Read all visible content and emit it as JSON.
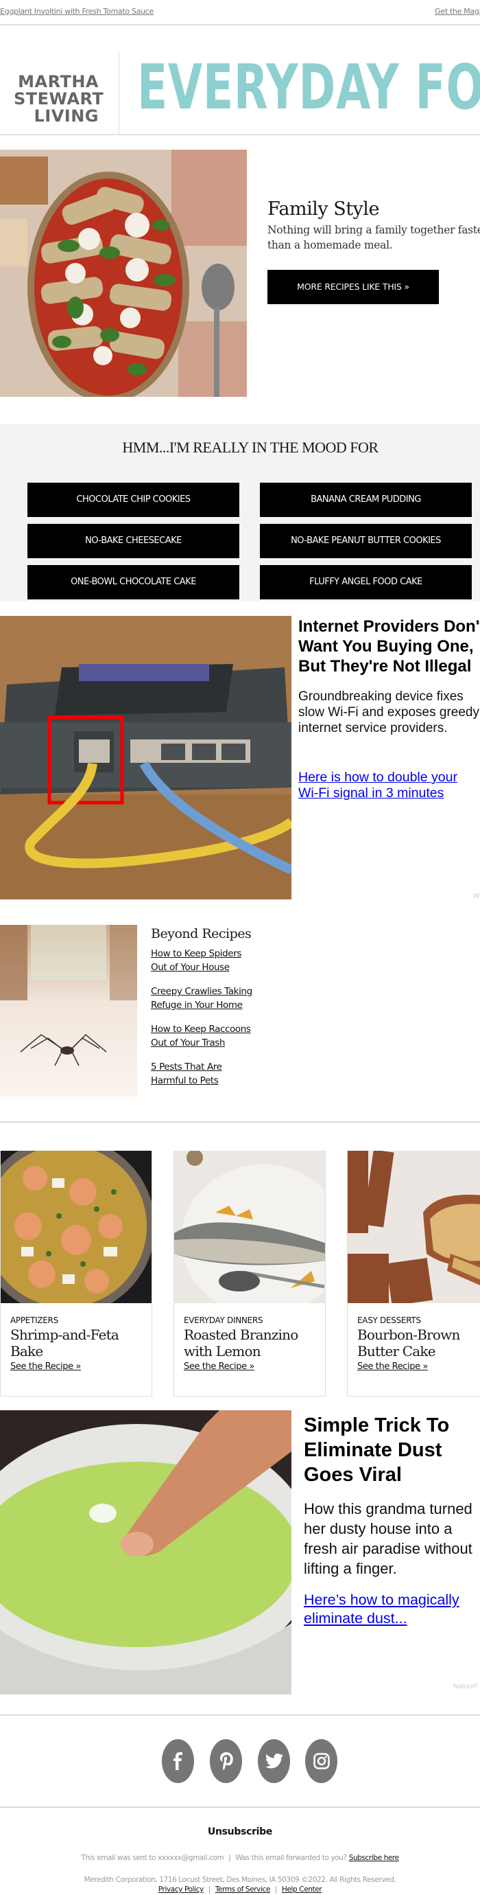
{
  "topbar": {
    "left_link": "Eggplant Involtini with Fresh Tomato Sauce",
    "right_link": "Get the Magazine"
  },
  "header": {
    "brand_lines": [
      "MARTHA",
      "STEWART",
      "LIVING"
    ],
    "newsletter_title": "EVERYDAY FOOD",
    "accent_color": "#8ecfcf"
  },
  "hero": {
    "image_alt": "Eggplant involtini in tomato sauce with basil",
    "title": "Family Style",
    "description_lines": [
      "Nothing will bring a family together faster",
      "than a homemade meal."
    ],
    "button_label": "MORE RECIPES LIKE THIS »"
  },
  "mood": {
    "title": "HMM...I'M REALLY IN THE MOOD FOR",
    "buttons": [
      "CHOCOLATE CHIP COOKIES",
      "BANANA CREAM PUDDING",
      "NO-BAKE CHEESECAKE",
      "NO-BAKE PEANUT BUTTER COOKIES",
      "ONE-BOWL CHOCOLATE CAKE",
      "FLUFFY ANGEL FOOD CAKE"
    ]
  },
  "ad1": {
    "image_alt": "Router with highlighted ethernet port",
    "title_lines": [
      "Internet Providers Don't",
      "Want You Buying One,",
      "But They're Not Illegal"
    ],
    "description_lines": [
      "Groundbreaking device fixes",
      "slow Wi-Fi and exposes greedy",
      "internet service providers."
    ],
    "link_lines": [
      "Here is how to double your",
      "Wi-Fi signal in 3 minutes"
    ],
    "sponsor": "Wi"
  },
  "beyond": {
    "image_alt": "Spider on a floor",
    "title": "Beyond Recipes",
    "links": [
      [
        "How to Keep Spiders",
        "Out of Your House"
      ],
      [
        "Creepy Crawlies Taking",
        "Refuge in Your Home"
      ],
      [
        "How to Keep Raccoons",
        "Out of Your Trash"
      ],
      [
        "5 Pests That Are",
        "Harmful to Pets"
      ]
    ]
  },
  "cards": [
    {
      "category": "APPETIZERS",
      "title_lines": [
        "Shrimp-and-Feta",
        "Bake"
      ],
      "link": "See the Recipe »"
    },
    {
      "category": "EVERYDAY DINNERS",
      "title_lines": [
        "Roasted Branzino",
        "with Lemon"
      ],
      "link": "See the Recipe »"
    },
    {
      "category": "EASY DESSERTS",
      "title_lines": [
        "Bourbon-Brown",
        "Butter Cake"
      ],
      "link": "See the Recipe »"
    }
  ],
  "ad2": {
    "image_alt": "Finger dipped in green liquid in a bowl",
    "title_lines": [
      "Simple Trick To",
      "Eliminate Dust",
      "Goes Viral"
    ],
    "description_lines": [
      "How this grandma turned",
      "her dusty house into a",
      "fresh air paradise without",
      "lifting a finger."
    ],
    "link_lines": [
      "Here’s how to magically",
      "eliminate dust..."
    ],
    "sponsor": "NatureF"
  },
  "social": {
    "icons": [
      "facebook-icon",
      "pinterest-icon",
      "twitter-icon",
      "instagram-icon"
    ]
  },
  "footer": {
    "unsubscribe": "Unsubscribe",
    "sent_to_prefix": "This email was sent to xxxxxx@gmail.com",
    "forwarded_text": "Was this email forwarded to you?",
    "subscribe_link": "Subscribe here",
    "address": "Meredith Corporation, 1716 Locust Street, Des Moines, IA 50309 ©2022. All Rights Reserved.",
    "links": [
      "Privacy Policy",
      "Terms of Service",
      "Help Center"
    ],
    "separator": "|"
  }
}
